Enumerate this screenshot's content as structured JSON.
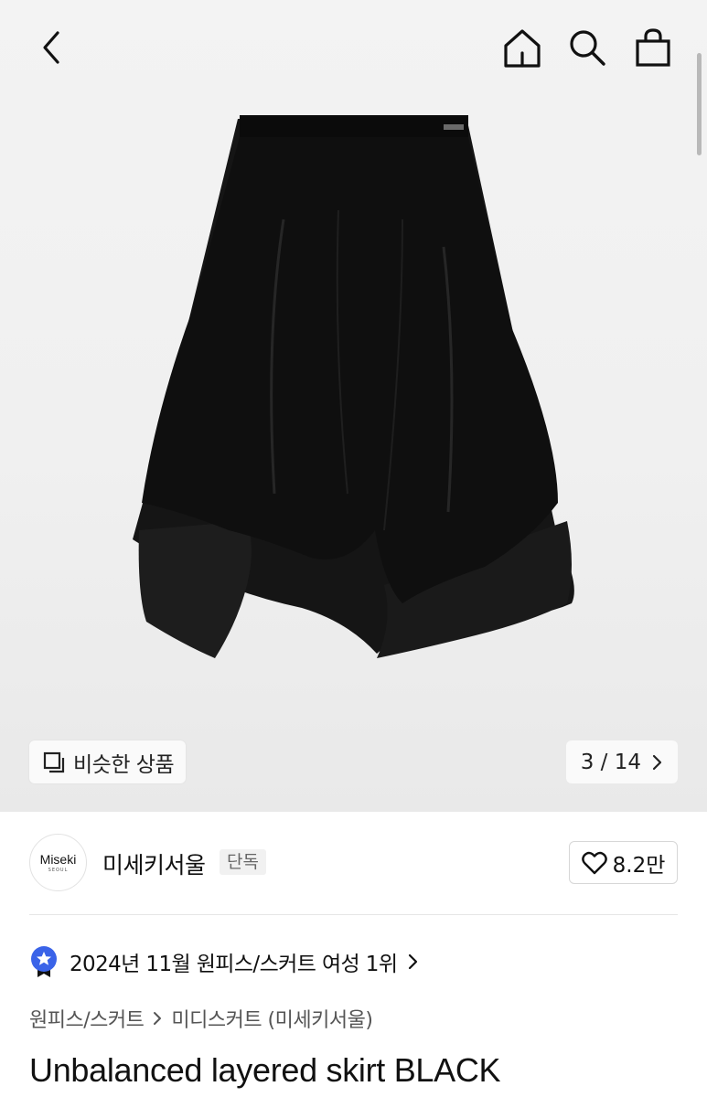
{
  "header": {
    "back_icon": "chevron-left-icon",
    "home_icon": "home-icon",
    "search_icon": "search-icon",
    "bag_icon": "shopping-bag-icon"
  },
  "gallery": {
    "similar_label": "비슷한 상품",
    "similar_icon": "layers-icon",
    "counter": "3 / 14",
    "current": 3,
    "total": 14,
    "product_color": "#0d0d0d"
  },
  "brand": {
    "logo_text": "Miseki",
    "logo_subtext": "SEOUL",
    "name": "미세키서울",
    "badge": "단독",
    "likes": "8.2만"
  },
  "ranking": {
    "text": "2024년 11월 원피스/스커트 여성 1위",
    "badge_color": "#3a63e8"
  },
  "breadcrumb": {
    "items": [
      "원피스/스커트",
      "미디스커트 (미세키서울)"
    ]
  },
  "product": {
    "title": "Unbalanced layered skirt BLACK"
  }
}
